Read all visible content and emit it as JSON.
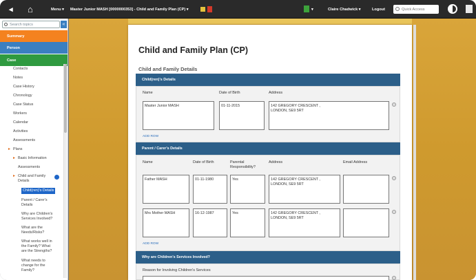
{
  "topbar": {
    "menu_label": "Menu ▾",
    "record_label": "Master Junior MASH [0000000353] - Child and Family Plan (CP) ▾",
    "notify_caret": "▾",
    "user_label": "Claire Chadwick ▾",
    "logout_label": "Logout",
    "quick_access_placeholder": "Quick Access"
  },
  "sidebar": {
    "search_placeholder": "Search topics",
    "collapse_glyph": "«",
    "categories": [
      "Summary",
      "Person",
      "Case"
    ],
    "items": [
      "Contacts",
      "Notes",
      "Case History",
      "Chronology",
      "Case Status",
      "Workers",
      "Calendar",
      "Activities",
      "Assessments",
      "Plans",
      "Basic Information",
      "Assessments",
      "Child and Family",
      "Details",
      "Child(ren)'s Details",
      "Parent / Carer's",
      "Details",
      "Why are Children's",
      "Services Involved?",
      "What are the",
      "Needs/Risks?",
      "What works well in",
      "the Family? What",
      "are the Strengths?",
      "What needs to",
      "change for the",
      "Family?"
    ]
  },
  "document": {
    "title": "Child and Family Plan (CP)",
    "section_title": "Child and Family Details",
    "children_panel": {
      "heading": "Child(ren)'s Details",
      "col_name": "Name",
      "col_dob": "Date of Birth",
      "col_address": "Address",
      "row": {
        "name": "Master Junior MASH",
        "dob": "01-11-2015",
        "address_line1": "142 GREGORY CRESCENT ,",
        "address_line2": "LONDON, SE9 5RT"
      },
      "add_link": "ADD ROW"
    },
    "parents_panel": {
      "heading": "Parent / Carer's Details",
      "col_name": "Name",
      "col_dob": "Date of Birth",
      "col_pr1": "Parental",
      "col_pr2": "Responsibility?",
      "col_address": "Address",
      "col_email": "Email Address",
      "rows": [
        {
          "name": "Father MASH",
          "dob": "01-11-1980",
          "pr": "Yes",
          "address_line1": "142 GREGORY CRESCENT ,",
          "address_line2": "LONDON, SE9 5RT",
          "email": ""
        },
        {
          "name": "Mrs Mother MASH",
          "dob": "16-12-1987",
          "pr": "Yes",
          "address_line1": "142 GREGORY CRESCENT ,",
          "address_line2": "LONDON, SE9 5RT",
          "email": ""
        }
      ],
      "add_link": "ADD ROW"
    },
    "why_panel": {
      "heading": "Why are Children's Services Involved?",
      "reason_label": "Reason for Involving Children's Services"
    }
  },
  "colors": {
    "summary": "#f4821f",
    "person": "#3a7fc1",
    "case": "#2f9a40",
    "panel_header": "#2c5f89",
    "gold_background": "#d9a53a"
  },
  "icons": [
    "back-arrow-icon",
    "home-icon",
    "star-icon",
    "alert-icon",
    "notification-icon",
    "search-icon",
    "contrast-icon",
    "settings-icon",
    "check-icon",
    "remove-row-icon"
  ]
}
